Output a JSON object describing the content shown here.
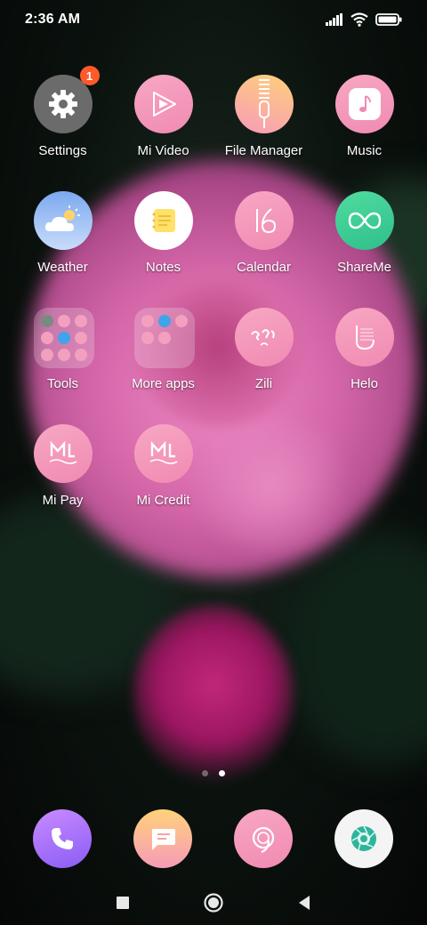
{
  "status_bar": {
    "time": "2:36 AM",
    "icons": [
      "signal-icon",
      "wifi-icon",
      "battery-icon"
    ]
  },
  "apps": [
    {
      "label": "Settings",
      "icon": "gear-icon",
      "badge": "1",
      "bg": "#6b6b6b"
    },
    {
      "label": "Mi Video",
      "icon": "play-icon",
      "bg": "#f59fbf"
    },
    {
      "label": "File Manager",
      "icon": "zipper-icon",
      "bg": "#f5b389"
    },
    {
      "label": "Music",
      "icon": "music-note-icon",
      "bg": "#f59fbf"
    },
    {
      "label": "Weather",
      "icon": "cloud-sun-icon",
      "bg": "#8fb8f2"
    },
    {
      "label": "Notes",
      "icon": "notepad-icon",
      "bg": "#ffffff"
    },
    {
      "label": "Calendar",
      "icon": "calendar-16-icon",
      "bg": "#f59fbf"
    },
    {
      "label": "ShareMe",
      "icon": "infinity-icon",
      "bg": "#3fcf95"
    },
    {
      "label": "Tools",
      "icon": "folder-icon",
      "folder": true
    },
    {
      "label": "More apps",
      "icon": "folder-icon",
      "folder": true
    },
    {
      "label": "Zili",
      "icon": "zili-logo-icon",
      "bg": "#f59fbf"
    },
    {
      "label": "Helo",
      "icon": "helo-logo-icon",
      "bg": "#f59fbf"
    },
    {
      "label": "Mi Pay",
      "icon": "mi-logo-icon",
      "bg": "#f59fbf"
    },
    {
      "label": "Mi Credit",
      "icon": "mi-logo-icon",
      "bg": "#f59fbf"
    }
  ],
  "pages": {
    "count": 2,
    "active": 2
  },
  "dock": [
    {
      "name": "phone",
      "icon": "phone-icon"
    },
    {
      "name": "messaging",
      "icon": "chat-bubble-icon"
    },
    {
      "name": "browser",
      "icon": "browser-icon"
    },
    {
      "name": "camera",
      "icon": "camera-shutter-icon"
    }
  ],
  "navbar": [
    "recents-icon",
    "home-icon",
    "back-icon"
  ],
  "colors": {
    "badge": "#ff5a2a",
    "icon_pink": "#f59fbf"
  }
}
